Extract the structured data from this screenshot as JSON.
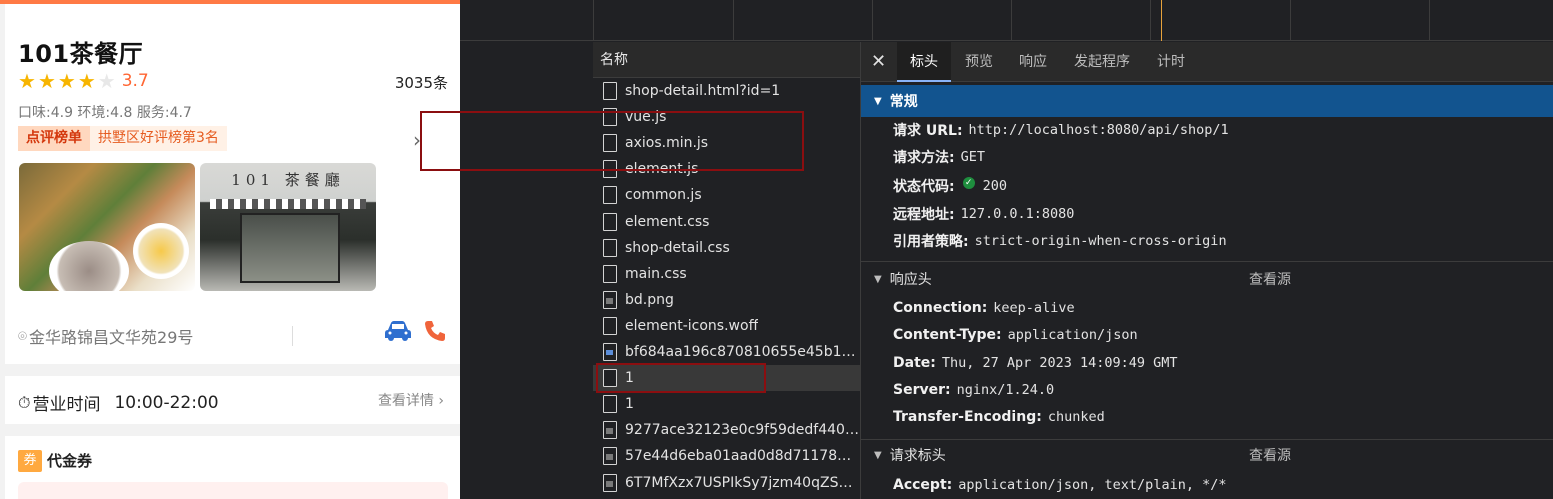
{
  "app": {
    "shop_name": "101茶餐厅",
    "stars": {
      "filled": 4,
      "total": 5
    },
    "score": "3.7",
    "review_count": "3035条",
    "sub_scores": "口味:4.9 环境:4.8 服务:4.7",
    "rank_tag": "点评榜单",
    "rank_text": "拱墅区好评榜第3名",
    "photo2_sign": "101 茶餐廳",
    "address": "金华路锦昌文华苑29号",
    "hours_label": "营业时间",
    "hours_value": "10:00-22:00",
    "hours_detail": "查看详情",
    "voucher_badge": "券",
    "voucher_title": "代金券",
    "colors": {
      "accent": "#ff6633",
      "star": "#f7b500",
      "car": "#2f6fcf",
      "phone": "#f0643b"
    }
  },
  "devtools": {
    "name_header": "名称",
    "requests": [
      {
        "name": "shop-detail.html?id=1",
        "icon": "file-icon"
      },
      {
        "name": "vue.js",
        "icon": "file-icon"
      },
      {
        "name": "axios.min.js",
        "icon": "file-icon"
      },
      {
        "name": "element.js",
        "icon": "file-icon"
      },
      {
        "name": "common.js",
        "icon": "file-icon"
      },
      {
        "name": "element.css",
        "icon": "file-icon"
      },
      {
        "name": "shop-detail.css",
        "icon": "file-icon"
      },
      {
        "name": "main.css",
        "icon": "file-icon"
      },
      {
        "name": "bd.png",
        "icon": "image-file-icon"
      },
      {
        "name": "element-icons.woff",
        "icon": "file-icon"
      },
      {
        "name": "bf684aa196c870810655e45b1e5...",
        "icon": "image-file-icon"
      },
      {
        "name": "1",
        "icon": "file-icon",
        "selected": true
      },
      {
        "name": "1",
        "icon": "file-icon"
      },
      {
        "name": "9277ace32123e0c9f59dedf44078...",
        "icon": "image-file-icon"
      },
      {
        "name": "57e44d6eba01aad0d8d711788f3...",
        "icon": "image-file-icon"
      },
      {
        "name": "6T7MfXzx7USPIkSy7jzm40qZSml...",
        "icon": "image-file-icon"
      }
    ],
    "tabs": [
      "标头",
      "预览",
      "响应",
      "发起程序",
      "计时"
    ],
    "active_tab": "标头",
    "general": {
      "title": "常规",
      "request_url_key": "请求 URL:",
      "request_url": "http://localhost:8080/api/shop/1",
      "request_method_key": "请求方法:",
      "request_method": "GET",
      "status_code_key": "状态代码:",
      "status_code": "200",
      "remote_address_key": "远程地址:",
      "remote_address": "127.0.0.1:8080",
      "referrer_policy_key": "引用者策略:",
      "referrer_policy": "strict-origin-when-cross-origin"
    },
    "response_headers": {
      "title": "响应头",
      "view_source": "查看源",
      "items": [
        {
          "key": "Connection:",
          "value": "keep-alive"
        },
        {
          "key": "Content-Type:",
          "value": "application/json"
        },
        {
          "key": "Date:",
          "value": "Thu, 27 Apr 2023 14:09:49 GMT"
        },
        {
          "key": "Server:",
          "value": "nginx/1.24.0"
        },
        {
          "key": "Transfer-Encoding:",
          "value": "chunked"
        }
      ]
    },
    "request_headers": {
      "title": "请求标头",
      "view_source": "查看源",
      "items": [
        {
          "key": "Accept:",
          "value": "application/json, text/plain, */*"
        }
      ]
    }
  }
}
